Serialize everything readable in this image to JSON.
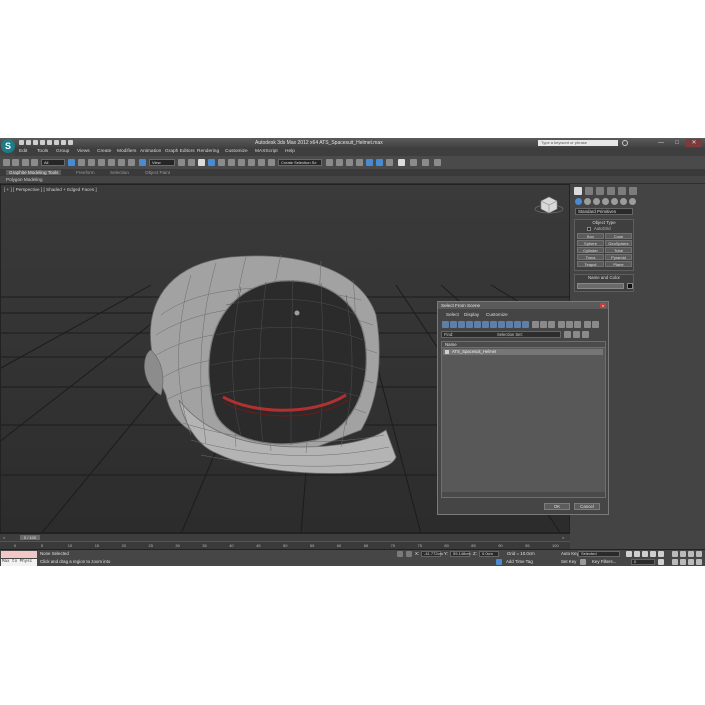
{
  "window": {
    "title": "Autodesk 3ds Max  2012 x64     ATS_Spacesuit_Helmet.max",
    "search_placeholder": "Type a keyword or phrase",
    "controls": [
      "—",
      "□",
      "✕"
    ]
  },
  "menubar": [
    "Edit",
    "Tools",
    "Group",
    "Views",
    "Create",
    "Modifiers",
    "Animation",
    "Graph Editors",
    "Rendering",
    "Customize",
    "MAXScript",
    "Help"
  ],
  "toolbar": {
    "filter_value": "All",
    "refcoord_value": "View",
    "named_selection_value": "Create Selection Se"
  },
  "ribbon": {
    "tabs": [
      "Graphite Modeling Tools",
      "Freeform",
      "Selection",
      "Object Paint"
    ],
    "subtab": "Polygon Modeling"
  },
  "viewport": {
    "label": "[ + ] [ Perspective ] [ Shaded + Edged Faces ]"
  },
  "command_panel": {
    "category": "Standard Primitives",
    "object_type_title": "Object Type",
    "autogrid": "AutoGrid",
    "buttons": [
      "Box",
      "Cone",
      "Sphere",
      "GeoSphere",
      "Cylinder",
      "Tube",
      "Torus",
      "Pyramid",
      "Teapot",
      "Plane"
    ],
    "name_color_title": "Name and Color"
  },
  "dialog": {
    "title": "Select From Scene",
    "close": "x",
    "menu": [
      "Select",
      "Display",
      "Customize"
    ],
    "find_label": "Find:",
    "selection_set_label": "Selection Set:",
    "column_name": "Name",
    "items": [
      "ATS_Spacesuit_Helmet"
    ],
    "ok": "OK",
    "cancel": "Cancel"
  },
  "timeline": {
    "slider": "0 / 100",
    "ticks": [
      "0",
      "5",
      "10",
      "15",
      "20",
      "25",
      "30",
      "35",
      "40",
      "45",
      "50",
      "55",
      "60",
      "65",
      "70",
      "75",
      "80",
      "85",
      "90",
      "95",
      "100"
    ]
  },
  "status": {
    "maxscript_text": "Max to Physc",
    "selection": "None Selected",
    "prompt": "Click and drag a region to zoom into",
    "x_label": "X:",
    "x_value": "-41.772cm",
    "y_label": "Y:",
    "y_value": "59.148cm",
    "z_label": "Z:",
    "z_value": "0.0cm",
    "grid": "Grid = 10.0cm",
    "add_time_tag": "Add Time Tag",
    "auto_key": "Auto Key",
    "auto_key_value": "Selected",
    "set_key": "Set Key",
    "key_filters": "Key Filters...",
    "frame": "0"
  },
  "colors": {
    "ui_bg": "#444444",
    "viewport_bg": "#333333",
    "grid_line": "#1a1a1a",
    "helmet_shell": "#9d9d9d",
    "visor_ring": "#b03030",
    "accent_blue": "#4a8ad0"
  }
}
